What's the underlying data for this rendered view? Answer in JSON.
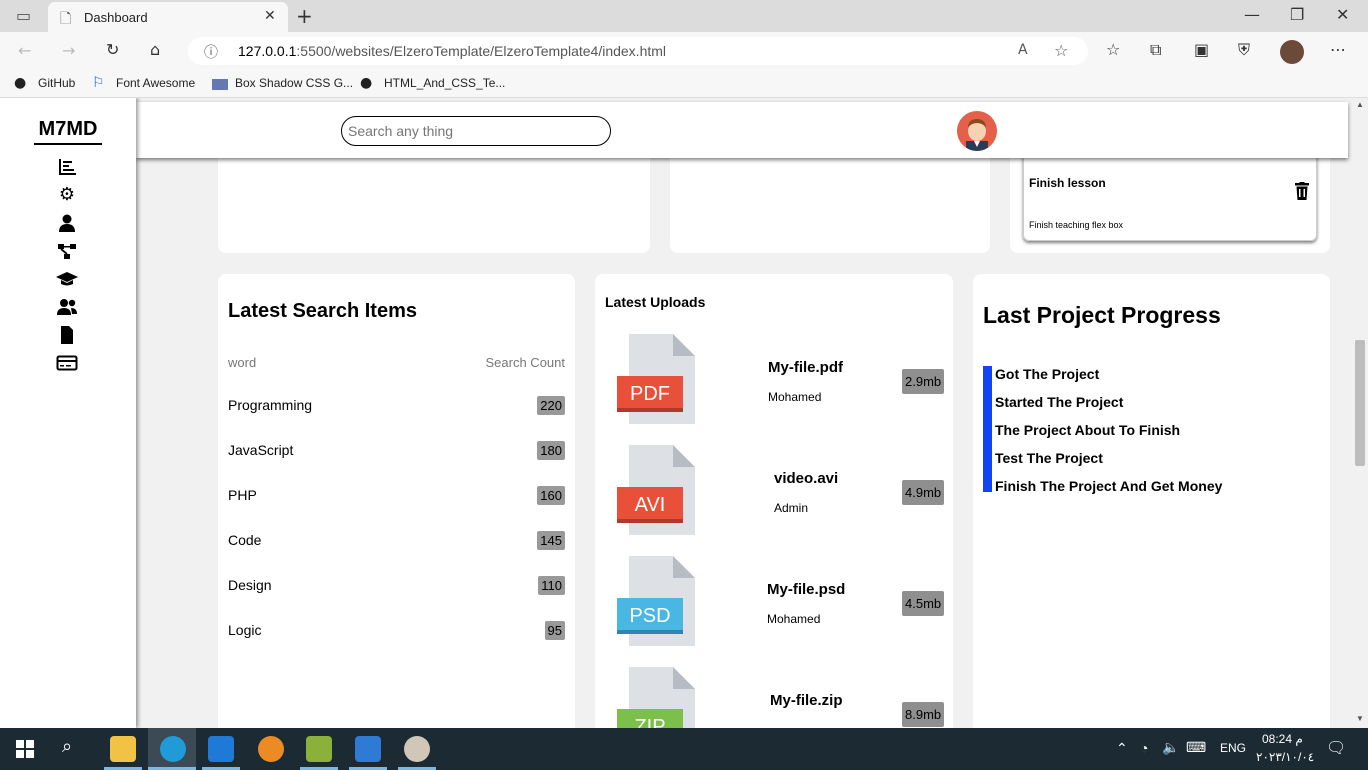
{
  "browser": {
    "tab_title": "Dashboard",
    "url_host": "127.0.0.1",
    "url_rest": ":5500/websites/ElzeroTemplate/ElzeroTemplate4/index.html",
    "bookmarks": [
      "GitHub",
      "Font Awesome",
      "Box Shadow CSS G...",
      "HTML_And_CSS_Te..."
    ]
  },
  "sidebar": {
    "logo": "M7MD",
    "icons": [
      "chart-icon",
      "gear-icon",
      "user-icon",
      "diagram-icon",
      "graduation-cap-icon",
      "users-icon",
      "file-icon",
      "credit-card-icon"
    ]
  },
  "topbar": {
    "search_placeholder": "Search any thing"
  },
  "task_card": {
    "title": "Finish lesson",
    "desc": "Finish teaching flex box"
  },
  "search_items": {
    "title": "Latest Search Items",
    "col_word": "word",
    "col_count": "Search Count",
    "rows": [
      {
        "word": "Programming",
        "count": "220"
      },
      {
        "word": "JavaScript",
        "count": "180"
      },
      {
        "word": "PHP",
        "count": "160"
      },
      {
        "word": "Code",
        "count": "145"
      },
      {
        "word": "Design",
        "count": "110"
      },
      {
        "word": "Logic",
        "count": "95"
      }
    ]
  },
  "uploads": {
    "title": "Latest Uploads",
    "items": [
      {
        "ext": "PDF",
        "name": "My-file.pdf",
        "user": "Mohamed",
        "size": "2.9mb",
        "color": "#e8503a"
      },
      {
        "ext": "AVI",
        "name": "video.avi",
        "user": "Admin",
        "size": "4.9mb",
        "color": "#e8503a"
      },
      {
        "ext": "PSD",
        "name": "My-file.psd",
        "user": "Mohamed",
        "size": "4.5mb",
        "color": "#4ab6e3"
      },
      {
        "ext": "ZIP",
        "name": "My-file.zip",
        "user": "",
        "size": "8.9mb",
        "color": "#7cc04b"
      }
    ]
  },
  "progress": {
    "title": "Last Project Progress",
    "steps": [
      "Got The Project",
      "Started The Project",
      "The Project About To Finish",
      "Test The Project",
      "Finish The Project And Get Money"
    ],
    "accent": "#1044f5"
  },
  "taskbar": {
    "lang": "ENG",
    "time": "08:24 م",
    "date": "٢٠٢٣/١٠/٠٤"
  }
}
